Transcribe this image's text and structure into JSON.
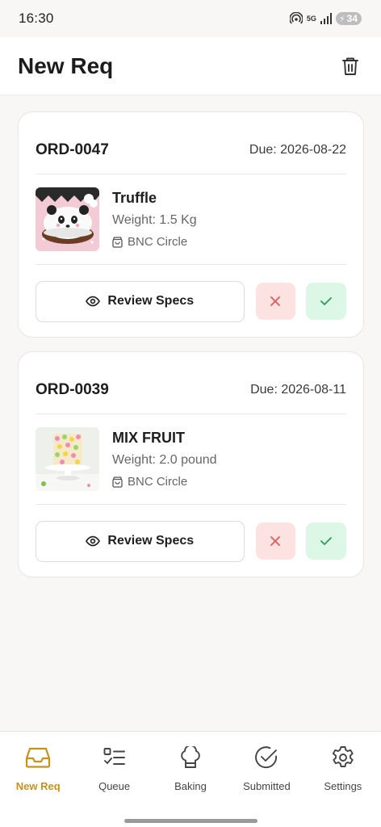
{
  "status_bar": {
    "time": "16:30",
    "network": "5G",
    "battery": "34"
  },
  "header": {
    "title": "New Req",
    "trash_icon": "trash-icon"
  },
  "orders": [
    {
      "id": "ORD-0047",
      "due": "Due: 2026-08-22",
      "item_name": "Truffle",
      "weight": "Weight: 1.5 Kg",
      "location": "BNC Circle",
      "review_label": "Review Specs",
      "thumb": "panda-cake-image"
    },
    {
      "id": "ORD-0039",
      "due": "Due: 2026-08-11",
      "item_name": "MIX FRUIT",
      "weight": "Weight: 2.0 pound",
      "location": "BNC Circle",
      "review_label": "Review Specs",
      "thumb": "fruit-cake-image"
    }
  ],
  "nav": {
    "items": [
      {
        "label": "New Req",
        "icon": "inbox-icon",
        "active": true
      },
      {
        "label": "Queue",
        "icon": "checklist-icon",
        "active": false
      },
      {
        "label": "Baking",
        "icon": "chef-hat-icon",
        "active": false
      },
      {
        "label": "Submitted",
        "icon": "check-circle-icon",
        "active": false
      },
      {
        "label": "Settings",
        "icon": "gear-icon",
        "active": false
      }
    ]
  },
  "colors": {
    "accent": "#c8921a",
    "reject_bg": "#fde2e2",
    "reject_icon": "#e05a5a",
    "accept_bg": "#dcf7e6",
    "accept_icon": "#2f9e5a"
  }
}
